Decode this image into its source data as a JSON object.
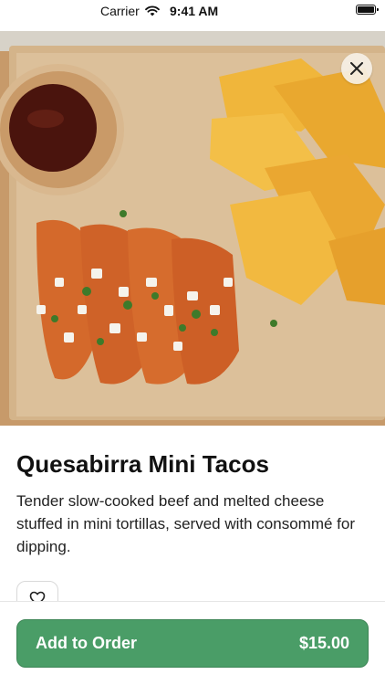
{
  "status_bar": {
    "carrier": "Carrier",
    "time": "9:41 AM"
  },
  "hero": {
    "image_subject": "quesabirria-tacos-photo"
  },
  "close_icon": "close-icon",
  "item": {
    "title": "Quesabirra Mini Tacos",
    "description": "Tender slow-cooked beef and melted cheese stuffed in mini tortillas, served with consommé for dipping."
  },
  "favorite_icon": "heart-icon",
  "order_button": {
    "label": "Add to Order",
    "price": "$15.00"
  },
  "colors": {
    "accent": "#4a9d67",
    "background": "#ffffff"
  }
}
